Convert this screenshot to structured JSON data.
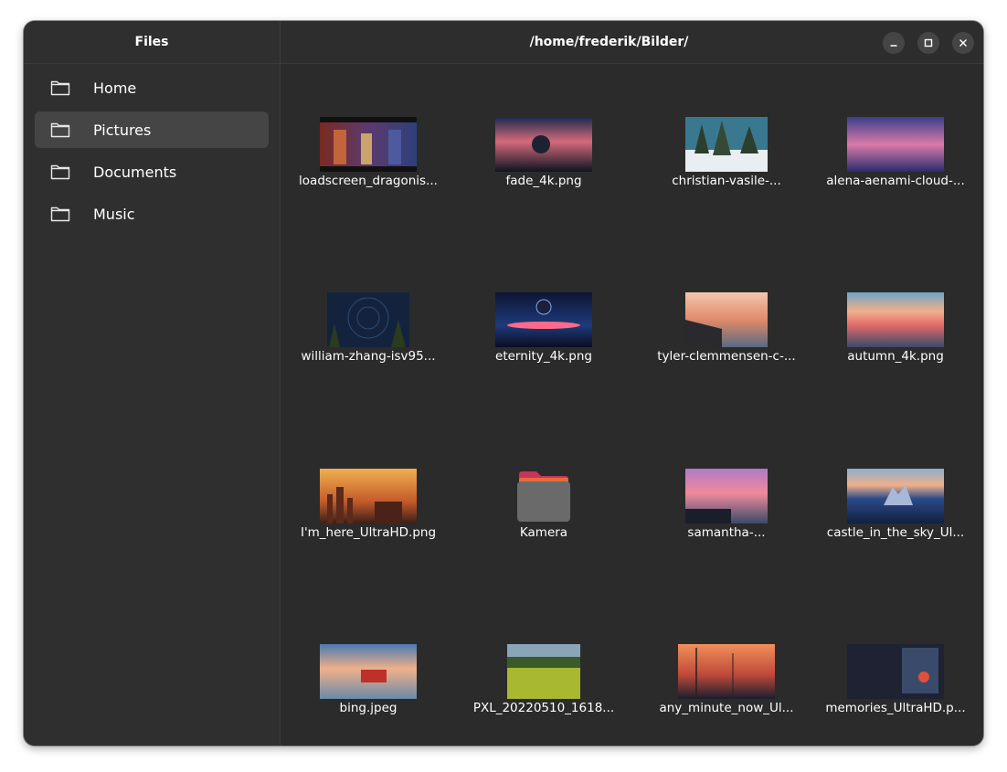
{
  "sidebar": {
    "title": "Files",
    "items": [
      {
        "label": "Home"
      },
      {
        "label": "Pictures"
      },
      {
        "label": "Documents"
      },
      {
        "label": "Music"
      }
    ]
  },
  "header": {
    "path": "/home/frederik/Bilder/"
  },
  "window_controls": [
    "minimize-icon",
    "maximize-icon",
    "close-icon"
  ],
  "files": [
    {
      "name": "loadscreen_dragonis...",
      "type": "image"
    },
    {
      "name": "fade_4k.png",
      "type": "image"
    },
    {
      "name": "christian-vasile-...",
      "type": "image"
    },
    {
      "name": "alena-aenami-cloud-...",
      "type": "image"
    },
    {
      "name": "william-zhang-isv95...",
      "type": "image"
    },
    {
      "name": "eternity_4k.png",
      "type": "image"
    },
    {
      "name": "tyler-clemmensen-c-...",
      "type": "image"
    },
    {
      "name": "autumn_4k.png",
      "type": "image"
    },
    {
      "name": "I'm_here_UltraHD.png",
      "type": "image"
    },
    {
      "name": "Kamera",
      "type": "folder"
    },
    {
      "name": "samantha-...",
      "type": "image"
    },
    {
      "name": "castle_in_the_sky_Ul...",
      "type": "image"
    },
    {
      "name": "bing.jpeg",
      "type": "image"
    },
    {
      "name": "PXL_20220510_1618...",
      "type": "image"
    },
    {
      "name": "any_minute_now_Ul...",
      "type": "image"
    },
    {
      "name": "memories_UltraHD.p...",
      "type": "image"
    }
  ],
  "colors": {
    "window_bg": "#2b2b2b",
    "sidebar_bg": "#2f2f2f",
    "selected_bg": "#454545",
    "folder_accent": "#e66a3c"
  }
}
